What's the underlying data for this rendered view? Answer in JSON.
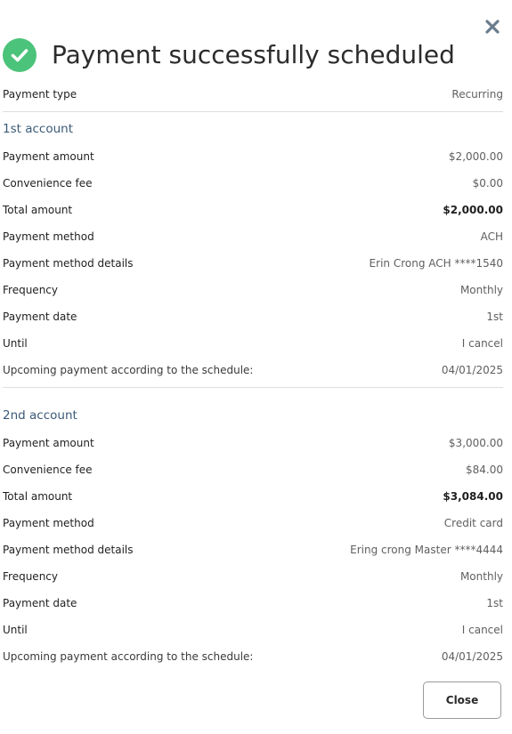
{
  "dialog": {
    "title": "Payment successfully scheduled",
    "close_icon": "close-x-icon",
    "success_icon": "check-circle-icon",
    "success_color": "#4cc37a"
  },
  "payment_type": {
    "label": "Payment type",
    "value": "Recurring"
  },
  "accounts": [
    {
      "title": "1st account",
      "payment_amount": {
        "label": "Payment amount",
        "value": "$2,000.00"
      },
      "convenience_fee": {
        "label": "Convenience fee",
        "value": "$0.00"
      },
      "total_amount": {
        "label": "Total amount",
        "value": "$2,000.00"
      },
      "payment_method": {
        "label": "Payment method",
        "value": "ACH"
      },
      "payment_method_details": {
        "label": "Payment method details",
        "value": "Erin Crong ACH ****1540"
      },
      "frequency": {
        "label": "Frequency",
        "value": "Monthly"
      },
      "payment_date": {
        "label": "Payment date",
        "value": "1st"
      },
      "until": {
        "label": "Until",
        "value": "I cancel"
      },
      "upcoming": {
        "label": "Upcoming payment according to the schedule:",
        "value": "04/01/2025"
      }
    },
    {
      "title": "2nd account",
      "payment_amount": {
        "label": "Payment amount",
        "value": "$3,000.00"
      },
      "convenience_fee": {
        "label": "Convenience fee",
        "value": "$84.00"
      },
      "total_amount": {
        "label": "Total amount",
        "value": "$3,084.00"
      },
      "payment_method": {
        "label": "Payment method",
        "value": "Credit card"
      },
      "payment_method_details": {
        "label": "Payment method details",
        "value": "Ering crong Master ****4444"
      },
      "frequency": {
        "label": "Frequency",
        "value": "Monthly"
      },
      "payment_date": {
        "label": "Payment date",
        "value": "1st"
      },
      "until": {
        "label": "Until",
        "value": "I cancel"
      },
      "upcoming": {
        "label": "Upcoming payment according to the schedule:",
        "value": "04/01/2025"
      }
    }
  ],
  "footer": {
    "close_label": "Close"
  }
}
